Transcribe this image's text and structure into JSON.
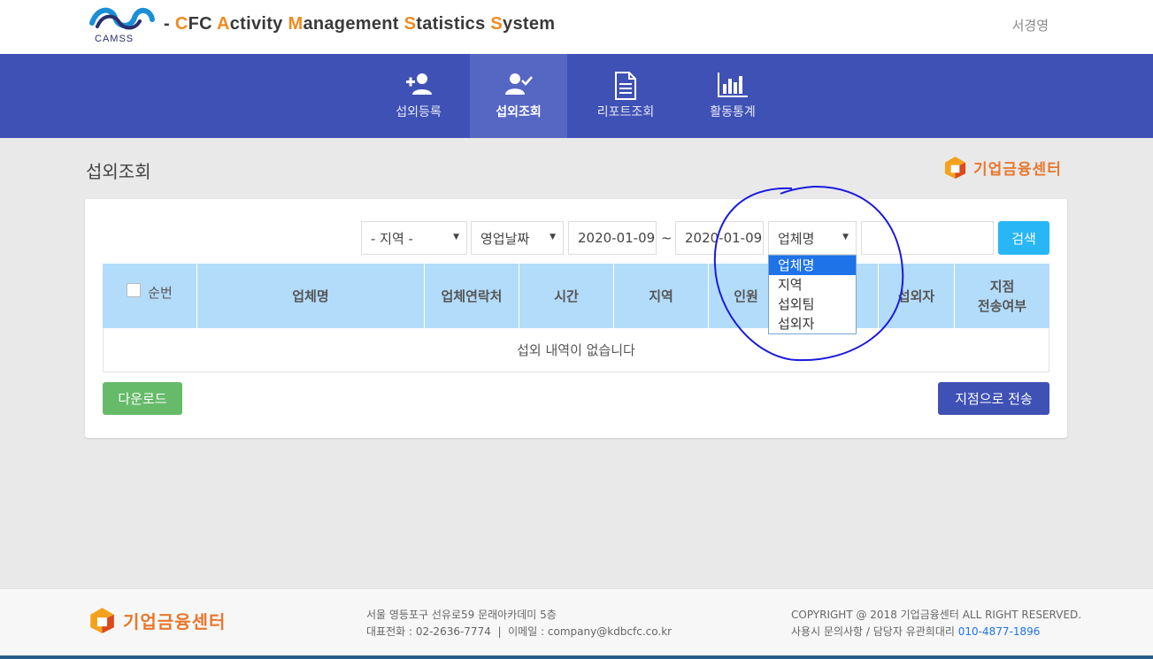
{
  "header": {
    "logo_text": "CAMSS",
    "title_prefix": "- ",
    "title_words": [
      {
        "initial": "C",
        "rest": "FC "
      },
      {
        "initial": "A",
        "rest": "ctivity "
      },
      {
        "initial": "M",
        "rest": "anagement "
      },
      {
        "initial": "S",
        "rest": "tatistics "
      },
      {
        "initial": "S",
        "rest": "ystem"
      }
    ],
    "user_name": "서경영"
  },
  "nav": {
    "items": [
      {
        "label": "섭외등록",
        "icon": "add-person-icon"
      },
      {
        "label": "섭외조회",
        "icon": "person-check-icon",
        "active": true
      },
      {
        "label": "리포트조회",
        "icon": "document-icon"
      },
      {
        "label": "활동통계",
        "icon": "bar-chart-icon"
      }
    ]
  },
  "page": {
    "title": "섭외조회",
    "brand": "기업금융센터"
  },
  "filters": {
    "region": "- 지역 -",
    "date_type": "영업날짜",
    "date_from": "2020-01-09",
    "date_separator": "~",
    "date_to": "2020-01-09",
    "field": "업체명",
    "keyword": "",
    "search_label": "검색"
  },
  "dropdown": {
    "options": [
      "업체명",
      "지역",
      "섭외팀",
      "섭외자"
    ],
    "selected_index": 0
  },
  "table": {
    "columns": [
      "순번",
      "업체명",
      "업체연락처",
      "시간",
      "지역",
      "인원",
      "",
      "섭외자",
      "지점\n전송여부"
    ],
    "empty_message": "섭외 내역이 없습니다"
  },
  "actions": {
    "download_label": "다운로드",
    "send_label": "지점으로 전송"
  },
  "footer": {
    "brand": "기업금융센터",
    "address": "서울 영등포구 선유로59 문래아카데미 5층",
    "contact": "대표전화 : 02-2636-7774  |  이메일 : company@kdbcfc.co.kr",
    "copyright": "COPYRIGHT @ 2018 기업금융센터 ALL RIGHT RESERVED.",
    "inquiry": "사용시 문의사항 / 담당자 유관희대리 ",
    "phone": "010-4877-1896"
  },
  "colors": {
    "nav_bg": "#3f51b5",
    "accent_orange": "#f08a1e",
    "table_header": "#b3dcfa",
    "search_btn": "#29b6f6",
    "download_btn": "#66bb6a",
    "annotation": "#1a1adf"
  }
}
